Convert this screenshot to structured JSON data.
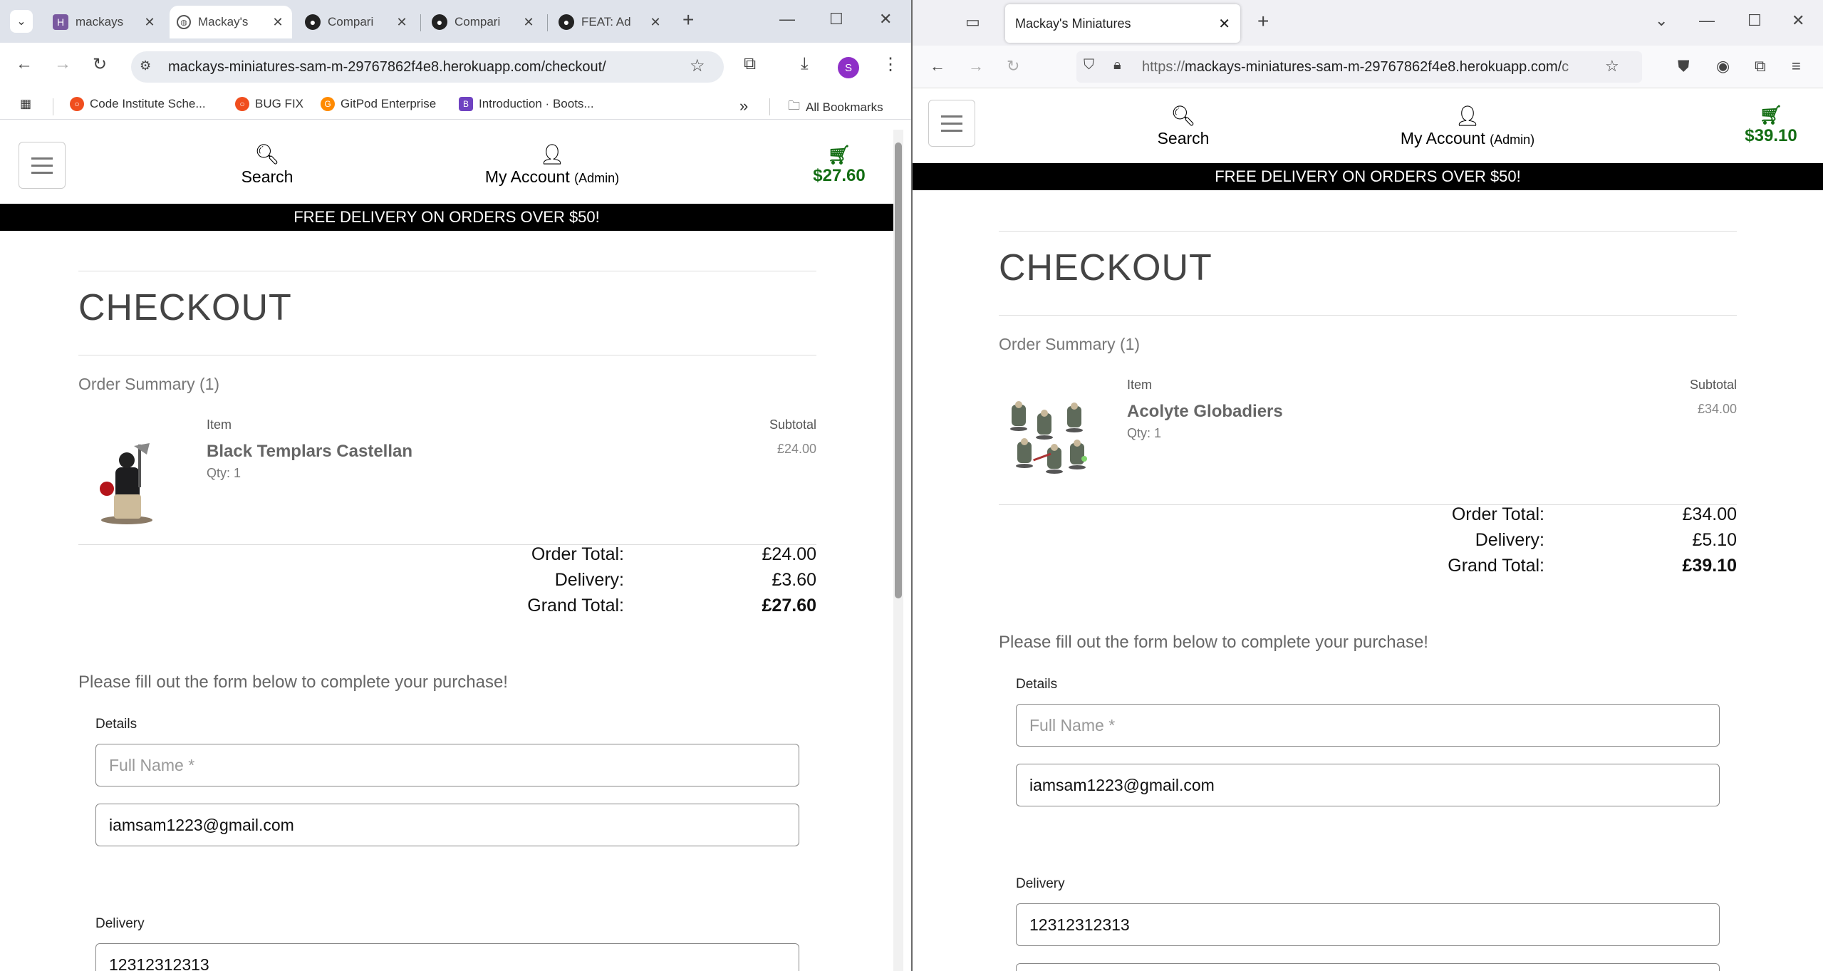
{
  "left_browser": {
    "tabs": [
      {
        "title": "mackays",
        "favicon": "heroku-icon"
      },
      {
        "title": "Mackay's",
        "favicon": "globe-icon"
      },
      {
        "title": "Compari",
        "favicon": "github-icon"
      },
      {
        "title": "Compari",
        "favicon": "github-icon"
      },
      {
        "title": "FEAT: Ad",
        "favicon": "github-icon"
      }
    ],
    "url": "mackays-miniatures-sam-m-29767862f4e8.herokuapp.com/checkout/",
    "avatar_letter": "S",
    "bookmarks": [
      {
        "label": "Code Institute Sche...",
        "color": "#f04e1e"
      },
      {
        "label": "BUG FIX",
        "color": "#f04e1e"
      },
      {
        "label": "GitPod Enterprise",
        "color": "#ff8a00"
      },
      {
        "label": "Introduction · Boots...",
        "color": "#6f42c1"
      }
    ],
    "more_bookmarks": "»",
    "all_bookmarks": "All Bookmarks"
  },
  "right_browser": {
    "tab_title": "Mackay's Miniatures",
    "url_prefix": "https://",
    "url_host": "mackays-miniatures-sam-m-29767862f4e8.herokuapp.com/",
    "url_suffix": "c"
  },
  "site_common": {
    "search_label": "Search",
    "account_label": "My Account",
    "account_role": "(Admin)",
    "banner": "FREE DELIVERY ON ORDERS OVER $50!",
    "heading": "CHECKOUT",
    "summary_title": "Order Summary (1)",
    "item_col": "Item",
    "subtotal_col": "Subtotal",
    "order_total_label": "Order Total:",
    "delivery_label": "Delivery:",
    "grand_total_label": "Grand Total:",
    "form_lead": "Please fill out the form below to complete your purchase!",
    "details_label": "Details",
    "full_name_placeholder": "Full Name *",
    "email_value": "iamsam1223@gmail.com",
    "delivery_section_label": "Delivery",
    "phone_value": "12312312313",
    "brand_green": "#136d13"
  },
  "left_site": {
    "bag_total": "$27.60",
    "item_name": "Black Templars Castellan",
    "qty": "Qty: 1",
    "subtotal": "£24.00",
    "order_total": "£24.00",
    "delivery": "£3.60",
    "grand_total": "£27.60"
  },
  "right_site": {
    "bag_total": "$39.10",
    "item_name": "Acolyte Globadiers",
    "qty": "Qty: 1",
    "subtotal": "£34.00",
    "order_total": "£34.00",
    "delivery": "£5.10",
    "grand_total": "£39.10"
  }
}
